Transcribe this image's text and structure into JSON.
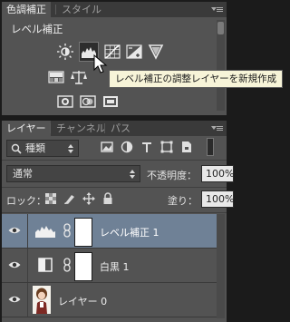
{
  "adjustments_panel": {
    "tabs": [
      {
        "label": "色調補正",
        "active": true
      },
      {
        "label": "スタイル",
        "active": false
      }
    ],
    "title": "レベル補正",
    "icons_row1": [
      "brightness-contrast-icon",
      "levels-icon",
      "curves-icon",
      "exposure-icon",
      "vibrance-icon"
    ],
    "icons_row2": [
      "hue-saturation-icon",
      "color-balance-icon"
    ],
    "icons_row3": [
      "photo-filter-icon",
      "channel-mixer-icon",
      "color-lookup-icon"
    ],
    "tooltip": "レベル補正の調整レイヤーを新規作成"
  },
  "layers_panel": {
    "tabs": [
      {
        "label": "レイヤー",
        "active": true
      },
      {
        "label": "チャンネル",
        "active": false
      },
      {
        "label": "パス",
        "active": false
      }
    ],
    "filter_kind": "種類",
    "blend_mode": "通常",
    "opacity_label": "不透明度：",
    "opacity_value": "100%",
    "lock_label": "ロック：",
    "fill_label": "塗り：",
    "fill_value": "100%",
    "layers": [
      {
        "name": "レベル補正 1",
        "type": "levels-adjustment",
        "selected": true,
        "visible": true
      },
      {
        "name": "白黒 1",
        "type": "black-white-adjustment",
        "selected": false,
        "visible": true
      },
      {
        "name": "レイヤー 0",
        "type": "pixel",
        "selected": false,
        "visible": true
      }
    ]
  },
  "colors": {
    "panel_bg": "#535353",
    "tab_bar_bg": "#3a3a3a",
    "selected_row": "#6f8196",
    "tooltip_bg": "#f7f4d8"
  }
}
